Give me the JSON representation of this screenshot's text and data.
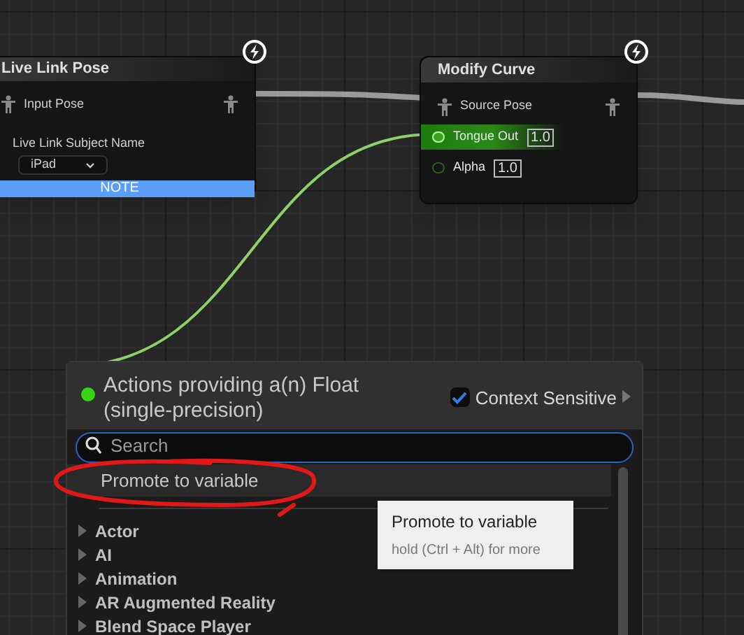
{
  "nodes": [
    {
      "title": "Live Link Pose",
      "pins": [
        {
          "kind": "pose",
          "label": "Input Pose"
        },
        {
          "kind": "dropdown",
          "label": "Live Link Subject Name",
          "value": "iPad"
        }
      ],
      "note": "NOTE"
    },
    {
      "title": "Modify Curve",
      "pins": [
        {
          "kind": "pose",
          "label": "Source Pose"
        },
        {
          "kind": "float",
          "label": "Tongue Out",
          "value": "1.0",
          "selected": true
        },
        {
          "kind": "float",
          "label": "Alpha",
          "value": "1.0",
          "selected": false
        }
      ]
    }
  ],
  "menu": {
    "title": "Actions providing a(n) Float (single-precision)",
    "context_sensitive": {
      "label": "Context Sensitive",
      "checked": true
    },
    "search": {
      "placeholder": "Search"
    },
    "promote": "Promote to variable",
    "categories": [
      "Actor",
      "AI",
      "Animation",
      "AR Augmented Reality",
      "Blend Space Player"
    ]
  },
  "tooltip": {
    "title": "Promote to variable",
    "hint": "hold (Ctrl + Alt) for more"
  }
}
